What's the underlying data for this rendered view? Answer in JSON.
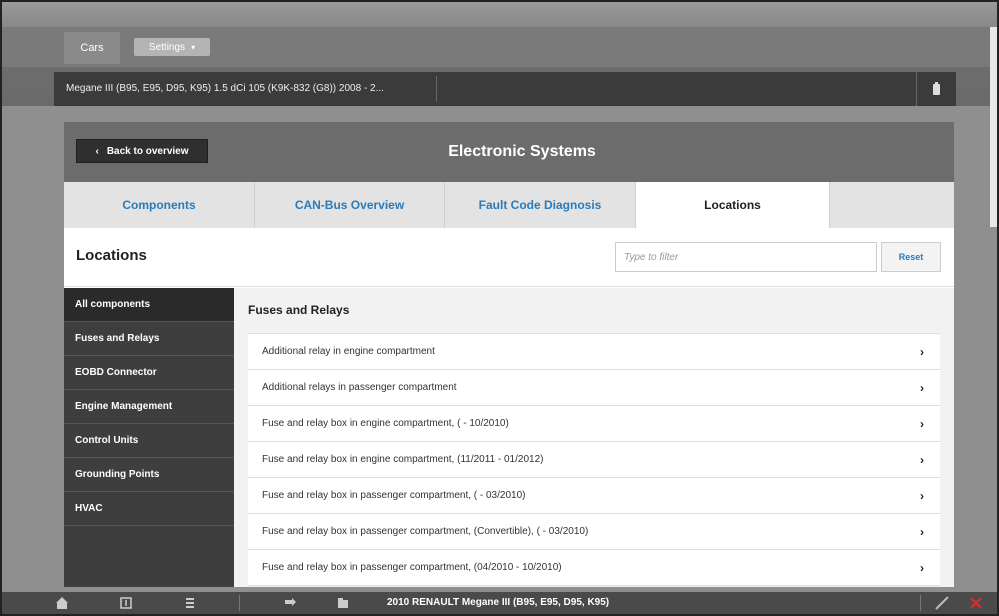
{
  "topbar": {
    "cars_tab": "Cars",
    "settings_label": "Settings"
  },
  "vehicle": {
    "title": "Megane III (B95, E95, D95, K95) 1.5 dCi 105 (K9K-832 (G8)) 2008 - 2..."
  },
  "header": {
    "back_label": "Back to overview",
    "title": "Electronic Systems"
  },
  "tabs": [
    {
      "label": "Components"
    },
    {
      "label": "CAN-Bus Overview"
    },
    {
      "label": "Fault Code Diagnosis"
    },
    {
      "label": "Locations"
    }
  ],
  "section": {
    "title": "Locations",
    "filter_placeholder": "Type to filter",
    "reset_label": "Reset"
  },
  "sidebar": {
    "items": [
      {
        "label": "All components"
      },
      {
        "label": "Fuses and Relays"
      },
      {
        "label": "EOBD Connector"
      },
      {
        "label": "Engine Management"
      },
      {
        "label": "Control Units"
      },
      {
        "label": "Grounding Points"
      },
      {
        "label": "HVAC"
      }
    ]
  },
  "content": {
    "title": "Fuses and Relays",
    "items": [
      {
        "label": "Additional relay in engine compartment"
      },
      {
        "label": "Additional relays in passenger compartment"
      },
      {
        "label": "Fuse and relay box in engine compartment, ( - 10/2010)"
      },
      {
        "label": "Fuse and relay box in engine compartment, (11/2011 - 01/2012)"
      },
      {
        "label": "Fuse and relay box in passenger compartment, ( - 03/2010)"
      },
      {
        "label": "Fuse and relay box in passenger compartment, (Convertible), ( - 03/2010)"
      },
      {
        "label": "Fuse and relay box in passenger compartment, (04/2010 - 10/2010)"
      }
    ]
  },
  "bottom": {
    "vehicle_label": "2010 RENAULT Megane III (B95, E95, D95, K95)"
  },
  "colors": {
    "accent": "#2b7bb9",
    "sidebar_bg": "#3e3e3e",
    "header_bg": "#6c6c6c"
  }
}
